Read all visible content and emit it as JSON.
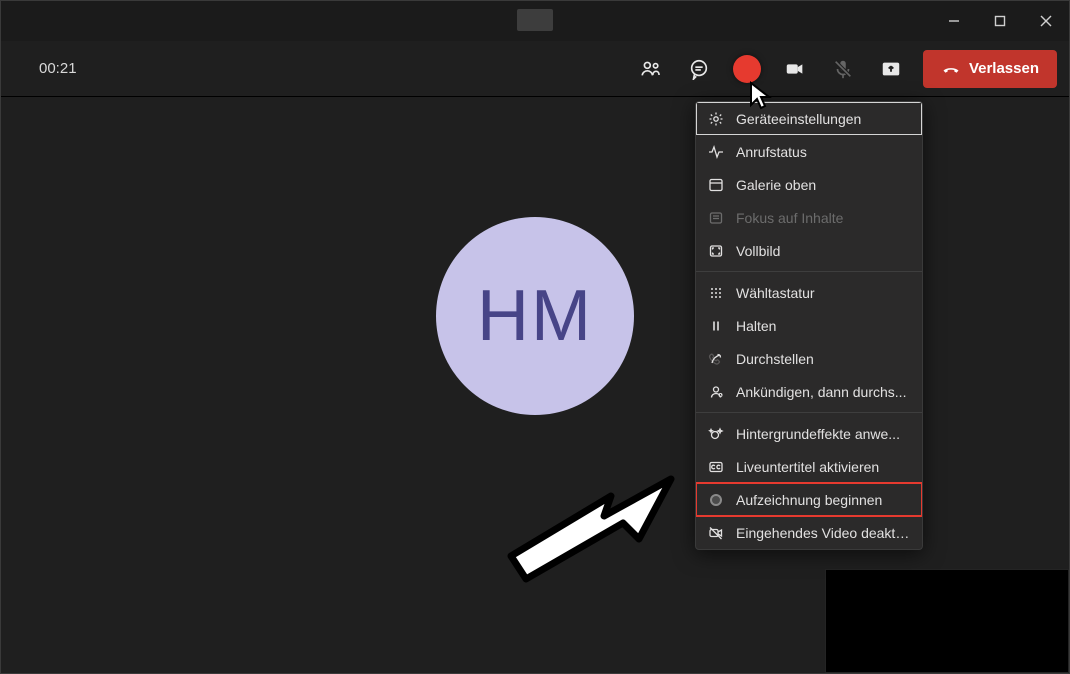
{
  "colors": {
    "leave_button": "#c1352c",
    "highlight": "#e63a2f",
    "avatar_bg": "#c7c3e9",
    "avatar_fg": "#474487"
  },
  "call": {
    "timer": "00:21",
    "avatar_initials": "HM"
  },
  "toolbar": {
    "leave_label": "Verlassen"
  },
  "title_bar": {
    "minimize": "Minimize",
    "maximize": "Maximize",
    "close": "Close"
  },
  "menu": {
    "sections": [
      [
        {
          "id": "device-settings",
          "label": "Geräteeinstellungen",
          "icon": "gear",
          "disabled": false,
          "framed": true
        },
        {
          "id": "call-health",
          "label": "Anrufstatus",
          "icon": "activity",
          "disabled": false
        },
        {
          "id": "gallery-top",
          "label": "Galerie oben",
          "icon": "layout",
          "disabled": false
        },
        {
          "id": "focus-content",
          "label": "Fokus auf Inhalte",
          "icon": "focus",
          "disabled": true
        },
        {
          "id": "fullscreen",
          "label": "Vollbild",
          "icon": "expand",
          "disabled": false
        }
      ],
      [
        {
          "id": "dialpad",
          "label": "Wähltastatur",
          "icon": "dialpad",
          "disabled": false
        },
        {
          "id": "hold",
          "label": "Halten",
          "icon": "pause",
          "disabled": false
        },
        {
          "id": "transfer",
          "label": "Durchstellen",
          "icon": "transfer",
          "disabled": false
        },
        {
          "id": "announce-transfer",
          "label": "Ankündigen, dann durchs...",
          "icon": "announce",
          "disabled": false
        }
      ],
      [
        {
          "id": "bg-effects",
          "label": "Hintergrundeffekte anwe...",
          "icon": "sparkle",
          "disabled": false
        },
        {
          "id": "live-captions",
          "label": "Liveuntertitel aktivieren",
          "icon": "cc",
          "disabled": false
        },
        {
          "id": "start-recording",
          "label": "Aufzeichnung beginnen",
          "icon": "record",
          "disabled": false,
          "record_highlight": true
        },
        {
          "id": "disable-incoming-video",
          "label": "Eingehendes Video deakti...",
          "icon": "video-off",
          "disabled": false
        }
      ]
    ]
  }
}
